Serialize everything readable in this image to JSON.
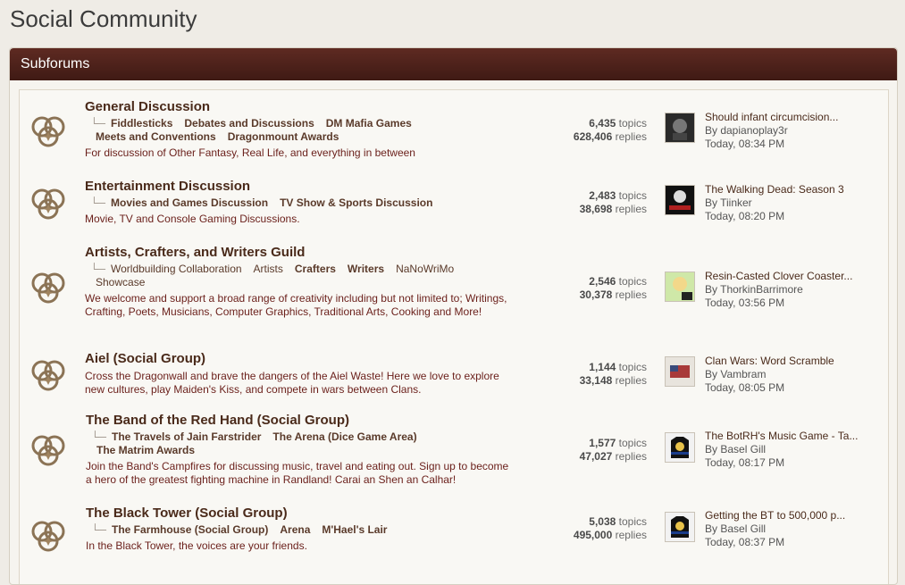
{
  "page": {
    "title": "Social Community"
  },
  "panel": {
    "header": "Subforums"
  },
  "forums": [
    {
      "title": "General Discussion",
      "subforums": [
        {
          "label": "Fiddlesticks"
        },
        {
          "label": "Debates and Discussions"
        },
        {
          "label": "DM Mafia Games"
        },
        {
          "label": "Meets and Conventions"
        },
        {
          "label": "Dragonmount Awards"
        }
      ],
      "description": "For discussion of Other Fantasy, Real Life, and everything in between",
      "topics": "6,435",
      "topics_label": "topics",
      "replies": "628,406",
      "replies_label": "replies",
      "last_title": "Should infant circumcision...",
      "last_by": "By dapianoplay3r",
      "last_time": "Today, 08:34 PM"
    },
    {
      "title": "Entertainment Discussion",
      "subforums": [
        {
          "label": "Movies and Games Discussion"
        },
        {
          "label": "TV Show & Sports Discussion"
        }
      ],
      "description": "Movie, TV and Console Gaming Discussions.",
      "topics": "2,483",
      "topics_label": "topics",
      "replies": "38,698",
      "replies_label": "replies",
      "last_title": "The Walking Dead: Season 3",
      "last_by": "By Tiinker",
      "last_time": "Today, 08:20 PM"
    },
    {
      "title": "Artists, Crafters, and Writers Guild",
      "subforums": [
        {
          "label": "Worldbuilding Collaboration"
        },
        {
          "label": "Artists"
        },
        {
          "label": "Crafters"
        },
        {
          "label": "Writers"
        },
        {
          "label": "NaNoWriMo"
        },
        {
          "label": "Showcase"
        }
      ],
      "description": "We welcome and support a broad range of creativity including but not limited to; Writings, Crafting, Poets, Musicians, Computer Graphics, Traditional Arts, Cooking and More!",
      "topics": "2,546",
      "topics_label": "topics",
      "replies": "30,378",
      "replies_label": "replies",
      "last_title": "Resin-Casted Clover Coaster...",
      "last_by": "By ThorkinBarrimore",
      "last_time": "Today, 03:56 PM"
    },
    {
      "title": "Aiel (Social Group)",
      "subforums": [],
      "description": "Cross the Dragonwall and brave the dangers of the Aiel Waste! Here we love to explore new cultures, play Maiden's Kiss, and compete in wars between Clans.",
      "topics": "1,144",
      "topics_label": "topics",
      "replies": "33,148",
      "replies_label": "replies",
      "last_title": "Clan Wars: Word Scramble",
      "last_by": "By Vambram",
      "last_time": "Today, 08:05 PM"
    },
    {
      "title": "The Band of the Red Hand (Social Group)",
      "subforums": [
        {
          "label": "The Travels of Jain Farstrider"
        },
        {
          "label": "The Arena (Dice Game Area)"
        },
        {
          "label": "The Matrim Awards"
        }
      ],
      "description": "Join the Band's Campfires for discussing music, travel and eating out. Sign up to become a hero of the greatest fighting machine in Randland! Carai an Shen an Calhar!",
      "topics": "1,577",
      "topics_label": "topics",
      "replies": "47,027",
      "replies_label": "replies",
      "last_title": "The BotRH's Music Game - Ta...",
      "last_by": "By Basel Gill",
      "last_time": "Today, 08:17 PM"
    },
    {
      "title": "The Black Tower (Social Group)",
      "subforums": [
        {
          "label": "The Farmhouse (Social Group)"
        },
        {
          "label": "Arena"
        },
        {
          "label": "M'Hael's Lair"
        }
      ],
      "description": "In the Black Tower, the voices are your friends.",
      "topics": "5,038",
      "topics_label": "topics",
      "replies": "495,000",
      "replies_label": "replies",
      "last_title": "Getting the BT to 500,000 p...",
      "last_by": "By Basel Gill",
      "last_time": "Today, 08:37 PM"
    }
  ]
}
